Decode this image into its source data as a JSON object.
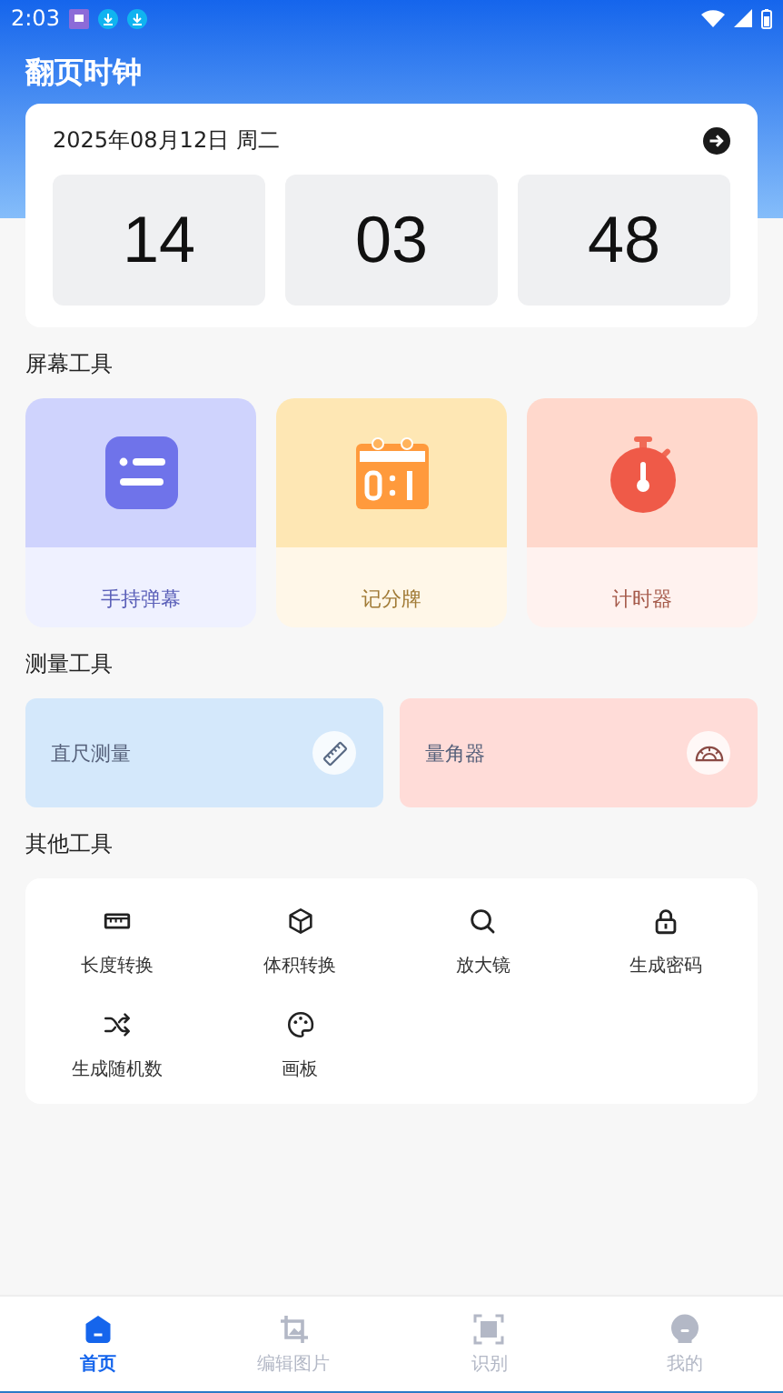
{
  "status_bar": {
    "time": "2:03"
  },
  "app_title": "翻页时钟",
  "clock_card": {
    "date": "2025年08月12日  周二",
    "digits": [
      "14",
      "03",
      "48"
    ]
  },
  "screen_tools": {
    "title": "屏幕工具",
    "items": [
      {
        "label": "手持弹幕",
        "kind": "danmaku"
      },
      {
        "label": "记分牌",
        "kind": "scoreboard"
      },
      {
        "label": "计时器",
        "kind": "timer"
      }
    ]
  },
  "measure_tools": {
    "title": "测量工具",
    "items": [
      {
        "label": "直尺测量",
        "kind": "ruler"
      },
      {
        "label": "量角器",
        "kind": "protractor"
      }
    ]
  },
  "other_tools": {
    "title": "其他工具",
    "items": [
      {
        "label": "长度转换",
        "kind": "length"
      },
      {
        "label": "体积转换",
        "kind": "volume"
      },
      {
        "label": "放大镜",
        "kind": "magnifier"
      },
      {
        "label": "生成密码",
        "kind": "password"
      },
      {
        "label": "生成随机数",
        "kind": "random"
      },
      {
        "label": "画板",
        "kind": "palette"
      }
    ]
  },
  "bottom_nav": [
    {
      "label": "首页",
      "kind": "home",
      "selected": true
    },
    {
      "label": "编辑图片",
      "kind": "edit",
      "selected": false
    },
    {
      "label": "识别",
      "kind": "scan",
      "selected": false
    },
    {
      "label": "我的",
      "kind": "profile",
      "selected": false
    }
  ]
}
